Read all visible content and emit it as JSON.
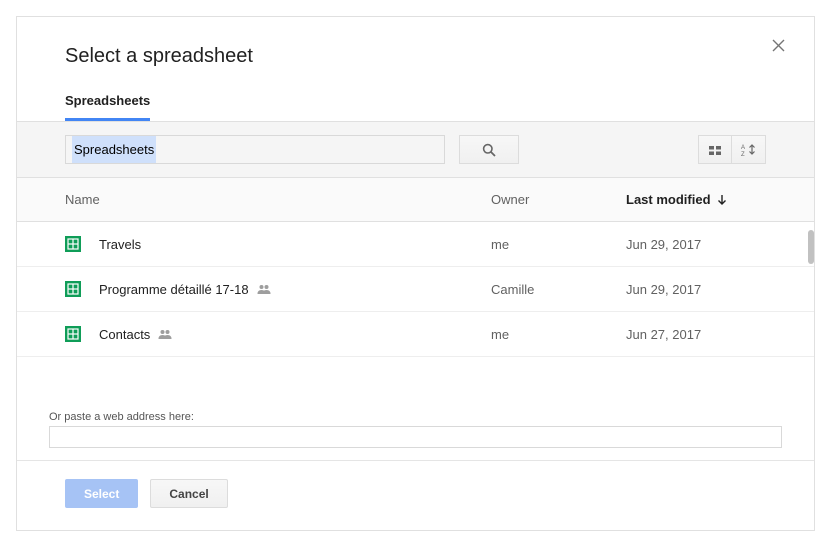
{
  "dialog": {
    "title": "Select a spreadsheet"
  },
  "tabs": {
    "spreadsheets": "Spreadsheets"
  },
  "search": {
    "value": "Spreadsheets",
    "placeholder": ""
  },
  "columns": {
    "name": "Name",
    "owner": "Owner",
    "modified": "Last modified"
  },
  "files": [
    {
      "name": "Travels",
      "owner": "me",
      "modified": "Jun 29, 2017",
      "shared": false
    },
    {
      "name": "Programme détaillé 17-18",
      "owner": "Camille",
      "modified": "Jun 29, 2017",
      "shared": true
    },
    {
      "name": "Contacts",
      "owner": "me",
      "modified": "Jun 27, 2017",
      "shared": true
    }
  ],
  "paste": {
    "label": "Or paste a web address here:",
    "value": ""
  },
  "buttons": {
    "select": "Select",
    "cancel": "Cancel"
  },
  "colors": {
    "accent": "#4285f4",
    "sheets_green": "#0f9d58"
  }
}
